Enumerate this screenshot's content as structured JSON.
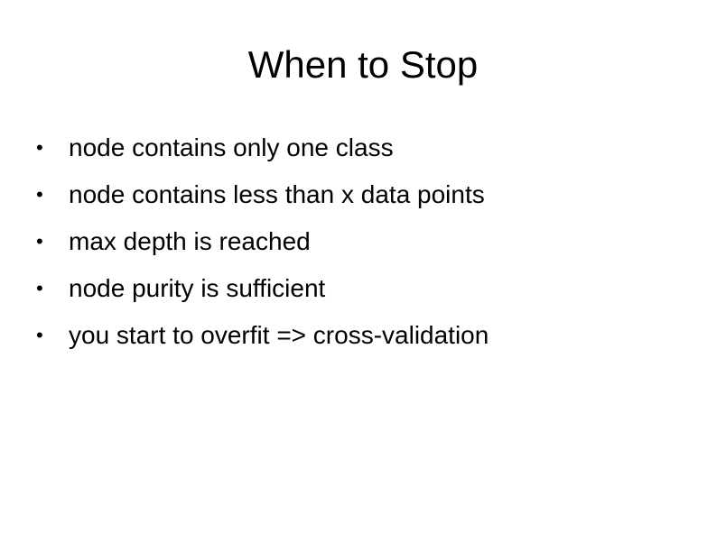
{
  "slide": {
    "title": "When to Stop",
    "bullet_symbol": "•",
    "bullets": [
      "node contains only one class",
      "node contains less than x data points",
      "max depth is reached",
      "node purity is sufficient",
      "you start to overfit => cross-validation"
    ]
  }
}
